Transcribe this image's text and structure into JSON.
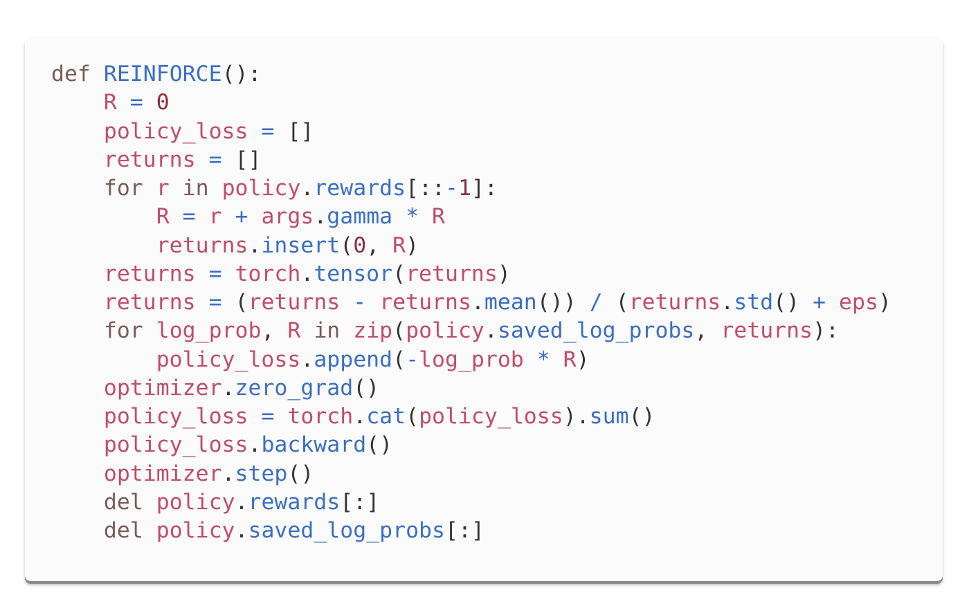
{
  "code": {
    "language": "python",
    "lines": [
      [
        {
          "t": "def",
          "c": "kw"
        },
        {
          "t": " ",
          "c": "p"
        },
        {
          "t": "REINFORCE",
          "c": "fn"
        },
        {
          "t": "():",
          "c": "p"
        }
      ],
      [
        {
          "t": "    ",
          "c": "p"
        },
        {
          "t": "R",
          "c": "var"
        },
        {
          "t": " ",
          "c": "p"
        },
        {
          "t": "=",
          "c": "op"
        },
        {
          "t": " ",
          "c": "p"
        },
        {
          "t": "0",
          "c": "num"
        }
      ],
      [
        {
          "t": "    ",
          "c": "p"
        },
        {
          "t": "policy_loss",
          "c": "var"
        },
        {
          "t": " ",
          "c": "p"
        },
        {
          "t": "=",
          "c": "op"
        },
        {
          "t": " []",
          "c": "p"
        }
      ],
      [
        {
          "t": "    ",
          "c": "p"
        },
        {
          "t": "returns",
          "c": "var"
        },
        {
          "t": " ",
          "c": "p"
        },
        {
          "t": "=",
          "c": "op"
        },
        {
          "t": " []",
          "c": "p"
        }
      ],
      [
        {
          "t": "    ",
          "c": "p"
        },
        {
          "t": "for",
          "c": "kw"
        },
        {
          "t": " ",
          "c": "p"
        },
        {
          "t": "r",
          "c": "var"
        },
        {
          "t": " ",
          "c": "p"
        },
        {
          "t": "in",
          "c": "kw"
        },
        {
          "t": " ",
          "c": "p"
        },
        {
          "t": "policy",
          "c": "var"
        },
        {
          "t": ".",
          "c": "p"
        },
        {
          "t": "rewards",
          "c": "fn"
        },
        {
          "t": "[::",
          "c": "p"
        },
        {
          "t": "-",
          "c": "op"
        },
        {
          "t": "1",
          "c": "num"
        },
        {
          "t": "]:",
          "c": "p"
        }
      ],
      [
        {
          "t": "        ",
          "c": "p"
        },
        {
          "t": "R",
          "c": "var"
        },
        {
          "t": " ",
          "c": "p"
        },
        {
          "t": "=",
          "c": "op"
        },
        {
          "t": " ",
          "c": "p"
        },
        {
          "t": "r",
          "c": "var"
        },
        {
          "t": " ",
          "c": "p"
        },
        {
          "t": "+",
          "c": "op"
        },
        {
          "t": " ",
          "c": "p"
        },
        {
          "t": "args",
          "c": "var"
        },
        {
          "t": ".",
          "c": "p"
        },
        {
          "t": "gamma",
          "c": "fn"
        },
        {
          "t": " ",
          "c": "p"
        },
        {
          "t": "*",
          "c": "op"
        },
        {
          "t": " ",
          "c": "p"
        },
        {
          "t": "R",
          "c": "var"
        }
      ],
      [
        {
          "t": "        ",
          "c": "p"
        },
        {
          "t": "returns",
          "c": "var"
        },
        {
          "t": ".",
          "c": "p"
        },
        {
          "t": "insert",
          "c": "fn"
        },
        {
          "t": "(",
          "c": "p"
        },
        {
          "t": "0",
          "c": "num"
        },
        {
          "t": ", ",
          "c": "p"
        },
        {
          "t": "R",
          "c": "var"
        },
        {
          "t": ")",
          "c": "p"
        }
      ],
      [
        {
          "t": "    ",
          "c": "p"
        },
        {
          "t": "returns",
          "c": "var"
        },
        {
          "t": " ",
          "c": "p"
        },
        {
          "t": "=",
          "c": "op"
        },
        {
          "t": " ",
          "c": "p"
        },
        {
          "t": "torch",
          "c": "var"
        },
        {
          "t": ".",
          "c": "p"
        },
        {
          "t": "tensor",
          "c": "fn"
        },
        {
          "t": "(",
          "c": "p"
        },
        {
          "t": "returns",
          "c": "var"
        },
        {
          "t": ")",
          "c": "p"
        }
      ],
      [
        {
          "t": "    ",
          "c": "p"
        },
        {
          "t": "returns",
          "c": "var"
        },
        {
          "t": " ",
          "c": "p"
        },
        {
          "t": "=",
          "c": "op"
        },
        {
          "t": " (",
          "c": "p"
        },
        {
          "t": "returns",
          "c": "var"
        },
        {
          "t": " ",
          "c": "p"
        },
        {
          "t": "-",
          "c": "op"
        },
        {
          "t": " ",
          "c": "p"
        },
        {
          "t": "returns",
          "c": "var"
        },
        {
          "t": ".",
          "c": "p"
        },
        {
          "t": "mean",
          "c": "fn"
        },
        {
          "t": "()) ",
          "c": "p"
        },
        {
          "t": "/",
          "c": "op"
        },
        {
          "t": " (",
          "c": "p"
        },
        {
          "t": "returns",
          "c": "var"
        },
        {
          "t": ".",
          "c": "p"
        },
        {
          "t": "std",
          "c": "fn"
        },
        {
          "t": "() ",
          "c": "p"
        },
        {
          "t": "+",
          "c": "op"
        },
        {
          "t": " ",
          "c": "p"
        },
        {
          "t": "eps",
          "c": "var"
        },
        {
          "t": ")",
          "c": "p"
        }
      ],
      [
        {
          "t": "    ",
          "c": "p"
        },
        {
          "t": "for",
          "c": "kw"
        },
        {
          "t": " ",
          "c": "p"
        },
        {
          "t": "log_prob",
          "c": "var"
        },
        {
          "t": ", ",
          "c": "p"
        },
        {
          "t": "R",
          "c": "var"
        },
        {
          "t": " ",
          "c": "p"
        },
        {
          "t": "in",
          "c": "kw"
        },
        {
          "t": " ",
          "c": "p"
        },
        {
          "t": "zip",
          "c": "var"
        },
        {
          "t": "(",
          "c": "p"
        },
        {
          "t": "policy",
          "c": "var"
        },
        {
          "t": ".",
          "c": "p"
        },
        {
          "t": "saved_log_probs",
          "c": "fn"
        },
        {
          "t": ", ",
          "c": "p"
        },
        {
          "t": "returns",
          "c": "var"
        },
        {
          "t": "):",
          "c": "p"
        }
      ],
      [
        {
          "t": "        ",
          "c": "p"
        },
        {
          "t": "policy_loss",
          "c": "var"
        },
        {
          "t": ".",
          "c": "p"
        },
        {
          "t": "append",
          "c": "fn"
        },
        {
          "t": "(",
          "c": "p"
        },
        {
          "t": "-",
          "c": "op"
        },
        {
          "t": "log_prob",
          "c": "var"
        },
        {
          "t": " ",
          "c": "p"
        },
        {
          "t": "*",
          "c": "op"
        },
        {
          "t": " ",
          "c": "p"
        },
        {
          "t": "R",
          "c": "var"
        },
        {
          "t": ")",
          "c": "p"
        }
      ],
      [
        {
          "t": "    ",
          "c": "p"
        },
        {
          "t": "optimizer",
          "c": "var"
        },
        {
          "t": ".",
          "c": "p"
        },
        {
          "t": "zero_grad",
          "c": "fn"
        },
        {
          "t": "()",
          "c": "p"
        }
      ],
      [
        {
          "t": "    ",
          "c": "p"
        },
        {
          "t": "policy_loss",
          "c": "var"
        },
        {
          "t": " ",
          "c": "p"
        },
        {
          "t": "=",
          "c": "op"
        },
        {
          "t": " ",
          "c": "p"
        },
        {
          "t": "torch",
          "c": "var"
        },
        {
          "t": ".",
          "c": "p"
        },
        {
          "t": "cat",
          "c": "fn"
        },
        {
          "t": "(",
          "c": "p"
        },
        {
          "t": "policy_loss",
          "c": "var"
        },
        {
          "t": ").",
          "c": "p"
        },
        {
          "t": "sum",
          "c": "fn"
        },
        {
          "t": "()",
          "c": "p"
        }
      ],
      [
        {
          "t": "    ",
          "c": "p"
        },
        {
          "t": "policy_loss",
          "c": "var"
        },
        {
          "t": ".",
          "c": "p"
        },
        {
          "t": "backward",
          "c": "fn"
        },
        {
          "t": "()",
          "c": "p"
        }
      ],
      [
        {
          "t": "    ",
          "c": "p"
        },
        {
          "t": "optimizer",
          "c": "var"
        },
        {
          "t": ".",
          "c": "p"
        },
        {
          "t": "step",
          "c": "fn"
        },
        {
          "t": "()",
          "c": "p"
        }
      ],
      [
        {
          "t": "    ",
          "c": "p"
        },
        {
          "t": "del",
          "c": "kw"
        },
        {
          "t": " ",
          "c": "p"
        },
        {
          "t": "policy",
          "c": "var"
        },
        {
          "t": ".",
          "c": "p"
        },
        {
          "t": "rewards",
          "c": "fn"
        },
        {
          "t": "[:]",
          "c": "p"
        }
      ],
      [
        {
          "t": "    ",
          "c": "p"
        },
        {
          "t": "del",
          "c": "kw"
        },
        {
          "t": " ",
          "c": "p"
        },
        {
          "t": "policy",
          "c": "var"
        },
        {
          "t": ".",
          "c": "p"
        },
        {
          "t": "saved_log_probs",
          "c": "fn"
        },
        {
          "t": "[:]",
          "c": "p"
        }
      ]
    ]
  },
  "colors": {
    "background": "#ffffff",
    "card": "#fbfbfb",
    "keyword": "#7a5a58",
    "function": "#3b6ec3",
    "variable": "#c14d68",
    "number": "#8a2f3e",
    "operator": "#3b6ec3",
    "punctuation": "#333333"
  }
}
